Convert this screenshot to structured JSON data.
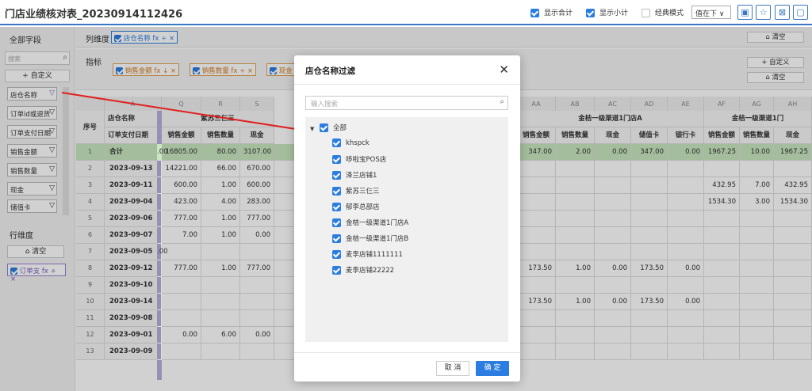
{
  "app": {
    "title": "门店业绩核对表_20230914112426",
    "options": [
      {
        "label": "显示合计",
        "checked": true
      },
      {
        "label": "显示小计",
        "checked": true
      },
      {
        "label": "经典模式",
        "checked": false
      }
    ],
    "value_position": "值在下 ∨"
  },
  "left_panel": {
    "title": "全部字段",
    "search_placeholder": "搜索",
    "custom_label": "+ 自定义",
    "fields": [
      "店仓名称",
      "订单id或退货",
      "订单支付日期",
      "销售金额",
      "销售数量",
      "现金",
      "储值卡"
    ],
    "row_dim_title": "行维度",
    "clear_label": "清空",
    "row_tag": "订单支 fx ÷ ×"
  },
  "column_bar": {
    "label": "列维度",
    "tag": "店仓名称 fx ÷ ×",
    "clear_label": "清空"
  },
  "metric_bar": {
    "label": "指标",
    "tags": [
      "销售金额 fx ↓ ×",
      "销售数量 fx ÷ ×",
      "现金"
    ],
    "custom_label": "+ 自定义",
    "clear_label": "清空"
  },
  "table": {
    "seq_header": "序号",
    "col_letters": [
      "A",
      "Q",
      "R",
      "S",
      "AA",
      "AB",
      "AC",
      "AD",
      "AE",
      "AF",
      "AG",
      "AH"
    ],
    "dim_header": "店仓名称",
    "date_header": "订单支付日期",
    "group_headers": [
      "紫苏三仨三",
      "金桔一级渠道1门店A",
      "金桔一级渠道1门"
    ],
    "left_metric_headers": [
      "销售金额",
      "销售数量",
      "现金"
    ],
    "right_metric_headers": [
      "销售金额",
      "销售数量",
      "现金",
      "储值卡",
      "银行卡",
      "销售金额",
      "销售数量",
      "现金"
    ],
    "rows": [
      {
        "n": "1",
        "date": "合计",
        "pre": ".00",
        "left": [
          "16805.00",
          "80.00",
          "3107.00"
        ],
        "right": [
          "347.00",
          "2.00",
          "0.00",
          "347.00",
          "0.00",
          "1967.25",
          "10.00",
          "1967.25"
        ]
      },
      {
        "n": "2",
        "date": "2023-09-13",
        "pre": "",
        "left": [
          "14221.00",
          "66.00",
          "670.00"
        ],
        "right": [
          "",
          "",
          "",
          "",
          "",
          "",
          "",
          ""
        ]
      },
      {
        "n": "3",
        "date": "2023-09-11",
        "pre": "",
        "left": [
          "600.00",
          "1.00",
          "600.00"
        ],
        "right": [
          "",
          "",
          "",
          "",
          "",
          "432.95",
          "7.00",
          "432.95"
        ]
      },
      {
        "n": "4",
        "date": "2023-09-04",
        "pre": "",
        "left": [
          "423.00",
          "4.00",
          "283.00"
        ],
        "right": [
          "",
          "",
          "",
          "",
          "",
          "1534.30",
          "3.00",
          "1534.30"
        ]
      },
      {
        "n": "5",
        "date": "2023-09-06",
        "pre": "",
        "left": [
          "777.00",
          "1.00",
          "777.00"
        ],
        "right": [
          "",
          "",
          "",
          "",
          "",
          "",
          "",
          ""
        ]
      },
      {
        "n": "6",
        "date": "2023-09-07",
        "pre": "",
        "left": [
          "7.00",
          "1.00",
          "0.00"
        ],
        "right": [
          "",
          "",
          "",
          "",
          "",
          "",
          "",
          ""
        ]
      },
      {
        "n": "7",
        "date": "2023-09-05",
        "pre": ".00",
        "left": [
          "",
          "",
          ""
        ],
        "right": [
          "",
          "",
          "",
          "",
          "",
          "",
          "",
          ""
        ]
      },
      {
        "n": "8",
        "date": "2023-09-12",
        "pre": "",
        "left": [
          "777.00",
          "1.00",
          "777.00"
        ],
        "right": [
          "173.50",
          "1.00",
          "0.00",
          "173.50",
          "0.00",
          "",
          "",
          ""
        ]
      },
      {
        "n": "9",
        "date": "2023-09-10",
        "pre": "",
        "left": [
          "",
          "",
          ""
        ],
        "right": [
          "",
          "",
          "",
          "",
          "",
          "",
          "",
          ""
        ]
      },
      {
        "n": "10",
        "date": "2023-09-14",
        "pre": "",
        "left": [
          "",
          "",
          ""
        ],
        "right": [
          "173.50",
          "1.00",
          "0.00",
          "173.50",
          "0.00",
          "",
          "",
          ""
        ]
      },
      {
        "n": "11",
        "date": "2023-09-08",
        "pre": "",
        "left": [
          "",
          "",
          ""
        ],
        "right": [
          "",
          "",
          "",
          "",
          "",
          "",
          "",
          ""
        ]
      },
      {
        "n": "12",
        "date": "2023-09-01",
        "pre": "",
        "left": [
          "0.00",
          "6.00",
          "0.00"
        ],
        "right": [
          "",
          "",
          "",
          "",
          "",
          "",
          "",
          ""
        ]
      },
      {
        "n": "13",
        "date": "2023-09-09",
        "pre": "",
        "left": [
          "",
          "",
          ""
        ],
        "right": [
          "",
          "",
          "",
          "",
          "",
          "",
          "",
          ""
        ]
      }
    ]
  },
  "dialog": {
    "title": "店仓名称过滤",
    "close": "✕",
    "search_placeholder": "输入搜索",
    "all_label": "全部",
    "items": [
      "khspck",
      "哆啦宝POS店",
      "泽兰店铺1",
      "紫苏三仨三",
      "郁李总部店",
      "金桔一级渠道1门店A",
      "金桔一级渠道1门店B",
      "麦李店铺1111111",
      "麦李店铺22222"
    ],
    "cancel_label": "取 消",
    "ok_label": "确 定"
  },
  "colors": {
    "accent": "#2b7de1",
    "header_rule": "#3a78c3",
    "total_row": "#c9e8c0",
    "arrow": "#e02020"
  }
}
